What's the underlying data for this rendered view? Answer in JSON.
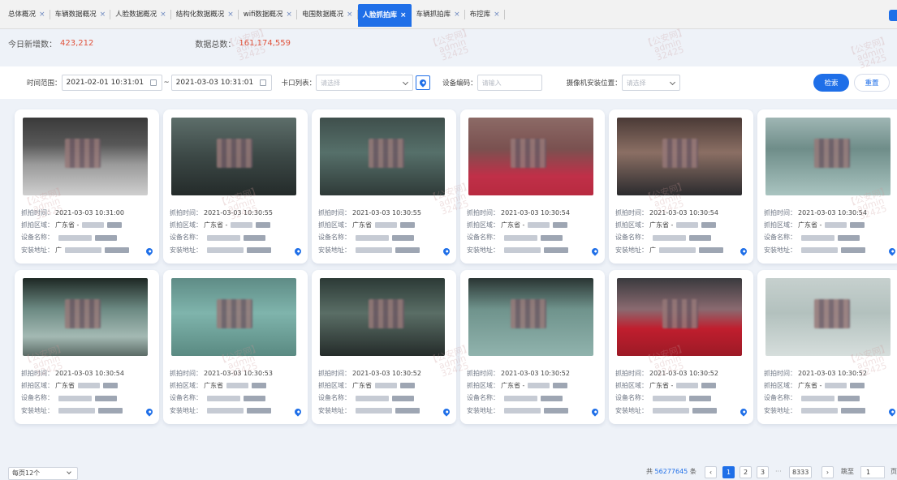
{
  "tabs": [
    {
      "label": "总体概况",
      "active": false
    },
    {
      "label": "车辆数据概况",
      "active": false
    },
    {
      "label": "人脸数据概况",
      "active": false
    },
    {
      "label": "结构化数据概况",
      "active": false
    },
    {
      "label": "wifi数据概况",
      "active": false
    },
    {
      "label": "电围数据概况",
      "active": false
    },
    {
      "label": "人脸抓拍库",
      "active": true
    },
    {
      "label": "车辆抓拍库",
      "active": false
    },
    {
      "label": "布控库",
      "active": false
    }
  ],
  "stats": {
    "today_label": "今日新增数：",
    "today_value": "423,212",
    "total_label": "数据总数：",
    "total_value": "161,174,559"
  },
  "filter": {
    "time_label": "时间范围：",
    "start_time": "2021-02-01 10:31:01",
    "range_sep": "~",
    "end_time": "2021-03-03 10:31:01",
    "checkpoint_label": "卡口列表：",
    "checkpoint_placeholder": "请选择",
    "device_label": "设备编码：",
    "device_placeholder": "请输入",
    "camera_label": "摄像机安装位置：",
    "camera_placeholder": "请选择",
    "search_label": "检索",
    "reset_label": "重置"
  },
  "card_labels": {
    "time": "抓拍时间：",
    "area": "抓拍区域：",
    "device": "设备名称：",
    "address": "安装地址："
  },
  "cards": [
    {
      "time": "2021-03-03 10:31:00",
      "area": "广东省 -",
      "device": "",
      "address": "广"
    },
    {
      "time": "2021-03-03 10:30:55",
      "area": "广东省 -",
      "device": "",
      "address": ""
    },
    {
      "time": "2021-03-03 10:30:55",
      "area": "广东省",
      "device": "",
      "address": ""
    },
    {
      "time": "2021-03-03 10:30:54",
      "area": "广东省 -",
      "device": "",
      "address": ""
    },
    {
      "time": "2021-03-03 10:30:54",
      "area": "广东省 -",
      "device": "",
      "address": "广"
    },
    {
      "time": "2021-03-03 10:30:54",
      "area": "广东省 -",
      "device": "",
      "address": ""
    },
    {
      "time": "2021-03-03 10:30:54",
      "area": "广东省",
      "device": "",
      "address": ""
    },
    {
      "time": "2021-03-03 10:30:53",
      "area": "广东省",
      "device": "",
      "address": ""
    },
    {
      "time": "2021-03-03 10:30:52",
      "area": "广东省",
      "device": "",
      "address": ""
    },
    {
      "time": "2021-03-03 10:30:52",
      "area": "广东省 -",
      "device": "",
      "address": ""
    },
    {
      "time": "2021-03-03 10:30:52",
      "area": "广东省 -",
      "device": "",
      "address": ""
    },
    {
      "time": "2021-03-03 10:30:52",
      "area": "广东省 -",
      "device": "",
      "address": ""
    }
  ],
  "pagination": {
    "page_size_label": "每页12个",
    "total_prefix": "共",
    "total_count": "56277645",
    "total_suffix": "条",
    "pages": [
      "1",
      "2",
      "3"
    ],
    "ellipsis": "···",
    "last_page": "8333",
    "jump_label": "跳至",
    "jump_value": "1",
    "jump_unit": "页"
  },
  "watermark": {
    "line1": "【公安网】",
    "line2": "admin",
    "line3": "32425"
  },
  "colors": {
    "accent": "#1f6fe8",
    "highlight_number": "#e0533c"
  }
}
